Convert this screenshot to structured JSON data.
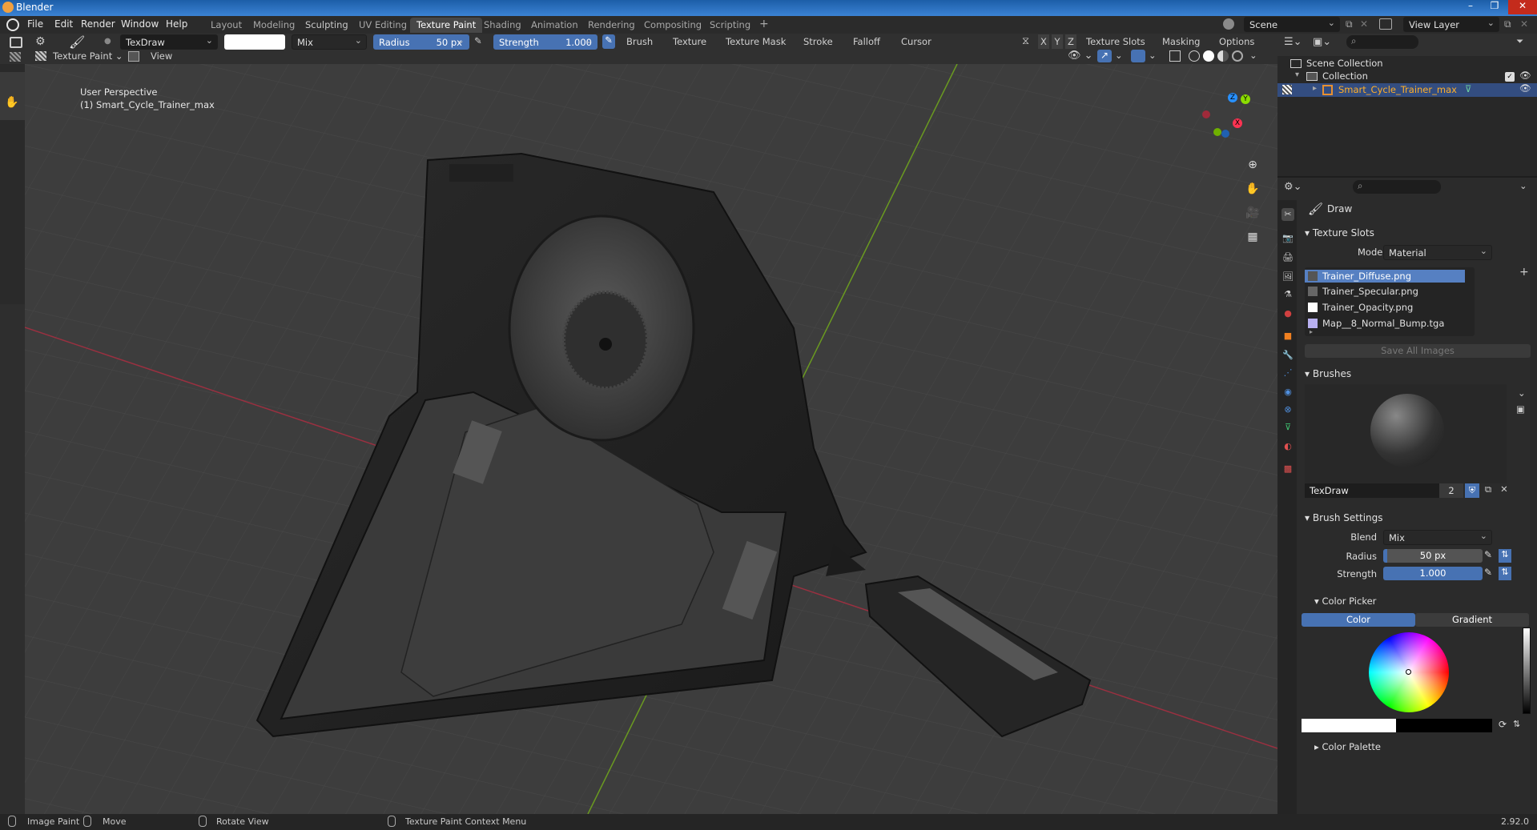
{
  "titlebar": {
    "title": "Blender"
  },
  "menu": [
    "File",
    "Edit",
    "Render",
    "Window",
    "Help"
  ],
  "workspaces": [
    "Layout",
    "Modeling",
    "Sculpting",
    "UV Editing",
    "Texture Paint",
    "Shading",
    "Animation",
    "Rendering",
    "Compositing",
    "Scripting"
  ],
  "workspace_add": "+",
  "scene": {
    "label": "Scene",
    "view_layer": "View Layer"
  },
  "tool_header": {
    "brush_name": "TexDraw",
    "blend": "Mix",
    "radius_label": "Radius",
    "radius_value": "50 px",
    "strength_label": "Strength",
    "strength_value": "1.000",
    "menus": [
      "Brush",
      "Texture",
      "Texture Mask",
      "Stroke",
      "Falloff",
      "Cursor"
    ],
    "axis": [
      "X",
      "Y",
      "Z"
    ],
    "right_menus": [
      "Texture Slots",
      "Masking",
      "Options"
    ]
  },
  "mode_header": {
    "mode": "Texture Paint",
    "view": "View"
  },
  "viewport": {
    "perspective": "User Perspective",
    "object": "(1) Smart_Cycle_Trainer_max"
  },
  "gizmo": {
    "x": "X",
    "y": "Y",
    "z": "Z"
  },
  "outliner": {
    "scene_collection": "Scene Collection",
    "collection": "Collection",
    "object": "Smart_Cycle_Trainer_max"
  },
  "properties": {
    "brush_title": "Draw",
    "texture_slots": {
      "header": "Texture Slots",
      "mode_label": "Mode",
      "mode_value": "Material",
      "slots": [
        "Trainer_Diffuse.png",
        "Trainer_Specular.png",
        "Trainer_Opacity.png",
        "Map__8_Normal_Bump.tga"
      ],
      "slot_colors": [
        "#555555",
        "#666666",
        "#ffffff",
        "#b8b0f0"
      ],
      "save_all": "Save All Images"
    },
    "brushes": {
      "header": "Brushes",
      "name": "TexDraw",
      "users": "2"
    },
    "brush_settings": {
      "header": "Brush Settings",
      "blend_label": "Blend",
      "blend_value": "Mix",
      "radius_label": "Radius",
      "radius_value": "50 px",
      "strength_label": "Strength",
      "strength_value": "1.000"
    },
    "color_picker": {
      "header": "Color Picker",
      "color_tab": "Color",
      "gradient_tab": "Gradient"
    },
    "color_palette": {
      "header": "Color Palette"
    }
  },
  "statusbar": {
    "image_paint": "Image Paint",
    "move": "Move",
    "rotate": "Rotate View",
    "context": "Texture Paint Context Menu",
    "version": "2.92.0"
  },
  "colors": {
    "accent": "#4772b3",
    "selected_object": "#5680c2",
    "x_axis": "#ff3352",
    "y_axis": "#8bdc00",
    "z_axis": "#2890ff"
  }
}
